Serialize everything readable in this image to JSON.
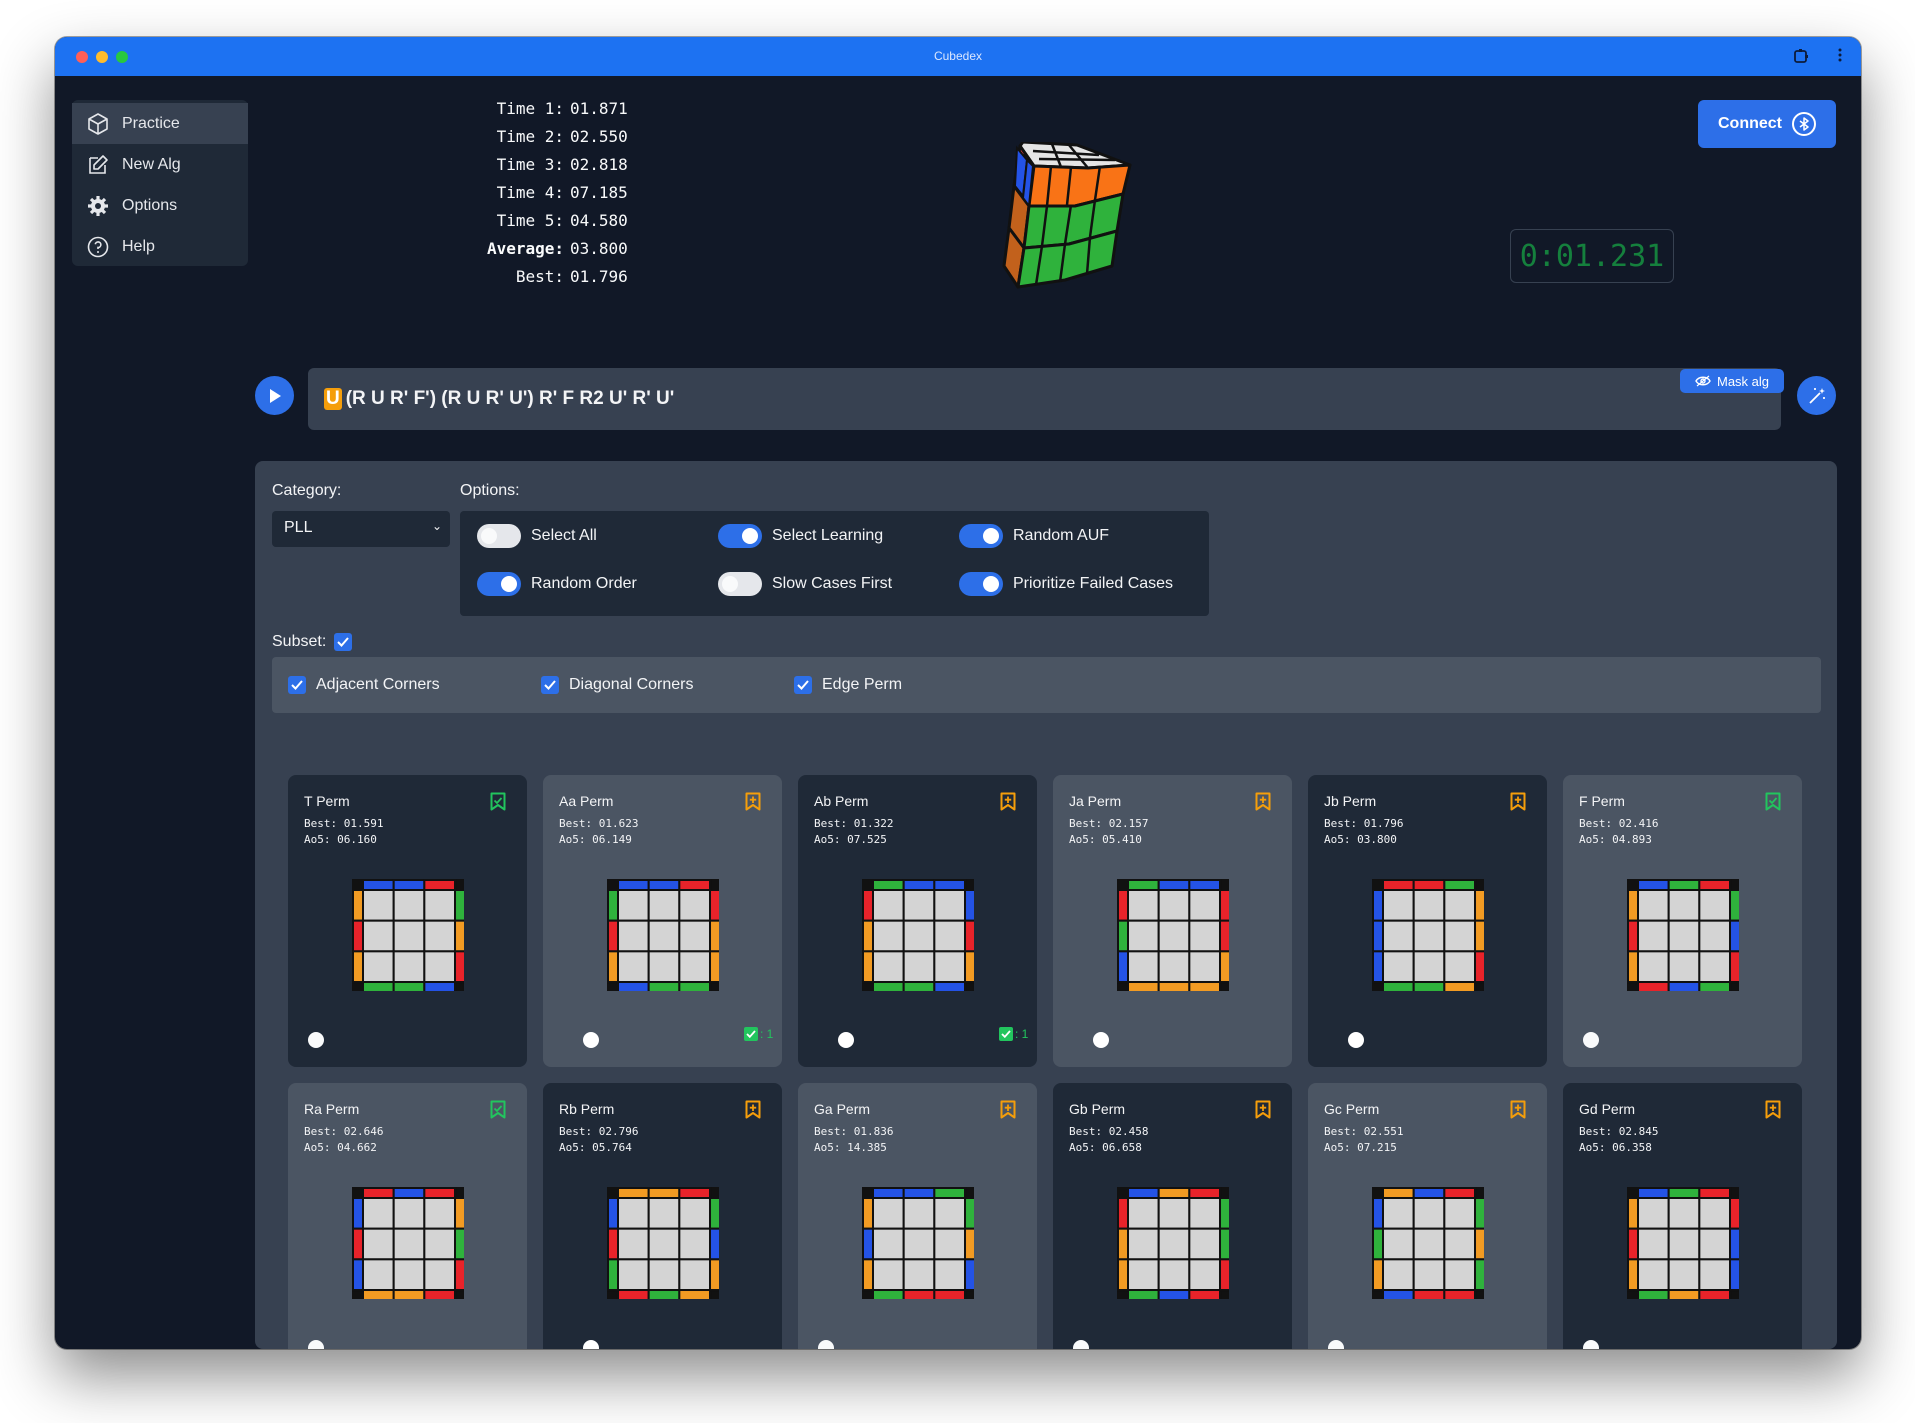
{
  "window": {
    "title": "Cubedex"
  },
  "sidebar": {
    "items": [
      {
        "label": "Practice",
        "icon": "cube-icon",
        "active": true
      },
      {
        "label": "New Alg",
        "icon": "edit-icon",
        "active": false
      },
      {
        "label": "Options",
        "icon": "gear-icon",
        "active": false
      },
      {
        "label": "Help",
        "icon": "help-circle-icon",
        "active": false
      }
    ]
  },
  "stats": {
    "rows": [
      {
        "label": "Time 1:",
        "value": "01.871"
      },
      {
        "label": "Time 2:",
        "value": "02.550"
      },
      {
        "label": "Time 3:",
        "value": "02.818"
      },
      {
        "label": "Time 4:",
        "value": "07.185"
      },
      {
        "label": "Time 5:",
        "value": "04.580"
      },
      {
        "label": "Average:",
        "value": "03.800"
      },
      {
        "label": "Best:",
        "value": "01.796"
      }
    ]
  },
  "connect": {
    "label": "Connect"
  },
  "timer": {
    "value": "0:01.231"
  },
  "alg": {
    "current_move": "U",
    "rest": "(R U R' F') (R U R' U') R' F R2 U' R' U'",
    "mask_label": "Mask alg"
  },
  "panel": {
    "category_label": "Category:",
    "category_value": "PLL",
    "options_label": "Options:",
    "options": [
      {
        "label": "Select All",
        "on": false
      },
      {
        "label": "Select Learning",
        "on": true
      },
      {
        "label": "Random AUF",
        "on": true
      },
      {
        "label": "Random Order",
        "on": true
      },
      {
        "label": "Slow Cases First",
        "on": false
      },
      {
        "label": "Prioritize Failed Cases",
        "on": true
      }
    ],
    "subset_label": "Subset:",
    "subsets": [
      {
        "label": "Adjacent Corners",
        "checked": true
      },
      {
        "label": "Diagonal Corners",
        "checked": true
      },
      {
        "label": "Edge Perm",
        "checked": true
      }
    ]
  },
  "colors": {
    "accent": "#2d6fe8",
    "red": "#e8232a",
    "blue": "#2453e6",
    "green": "#2fb23c",
    "orange": "#f29b23",
    "sticker": "#d4d4d4"
  },
  "cases": [
    {
      "name": "T Perm",
      "best": "Best: 01.591",
      "ao5": "Ao5: 06.160",
      "bookmark": "learned",
      "enabled": false,
      "count": "",
      "edges": {
        "top": [
          "b",
          "b",
          "r"
        ],
        "right": [
          "g",
          "o",
          "r"
        ],
        "bottom": [
          "g",
          "g",
          "b"
        ],
        "left": [
          "o",
          "r",
          "o"
        ]
      }
    },
    {
      "name": "Aa Perm",
      "best": "Best: 01.623",
      "ao5": "Ao5: 06.149",
      "bookmark": "learning",
      "enabled": true,
      "count": ": 1",
      "edges": {
        "top": [
          "b",
          "b",
          "r"
        ],
        "right": [
          "r",
          "o",
          "o"
        ],
        "bottom": [
          "b",
          "g",
          "g"
        ],
        "left": [
          "g",
          "r",
          "o"
        ]
      }
    },
    {
      "name": "Ab Perm",
      "best": "Best: 01.322",
      "ao5": "Ao5: 07.525",
      "bookmark": "learning",
      "enabled": true,
      "count": ": 1",
      "edges": {
        "top": [
          "g",
          "b",
          "b"
        ],
        "right": [
          "b",
          "r",
          "o"
        ],
        "bottom": [
          "g",
          "g",
          "b"
        ],
        "left": [
          "r",
          "o",
          "o"
        ]
      }
    },
    {
      "name": "Ja Perm",
      "best": "Best: 02.157",
      "ao5": "Ao5: 05.410",
      "bookmark": "learning",
      "enabled": true,
      "count": "",
      "edges": {
        "top": [
          "g",
          "b",
          "b"
        ],
        "right": [
          "r",
          "r",
          "o"
        ],
        "bottom": [
          "o",
          "o",
          "o"
        ],
        "left": [
          "r",
          "g",
          "b"
        ]
      }
    },
    {
      "name": "Jb Perm",
      "best": "Best: 01.796",
      "ao5": "Ao5: 03.800",
      "bookmark": "learning",
      "enabled": true,
      "count": "",
      "edges": {
        "top": [
          "r",
          "r",
          "g"
        ],
        "right": [
          "o",
          "o",
          "r"
        ],
        "bottom": [
          "g",
          "g",
          "o"
        ],
        "left": [
          "b",
          "b",
          "b"
        ]
      }
    },
    {
      "name": "F Perm",
      "best": "Best: 02.416",
      "ao5": "Ao5: 04.893",
      "bookmark": "learned",
      "enabled": false,
      "count": "",
      "edges": {
        "top": [
          "b",
          "g",
          "r"
        ],
        "right": [
          "g",
          "b",
          "r"
        ],
        "bottom": [
          "r",
          "b",
          "g"
        ],
        "left": [
          "o",
          "r",
          "o"
        ]
      }
    },
    {
      "name": "Ra Perm",
      "best": "Best: 02.646",
      "ao5": "Ao5: 04.662",
      "bookmark": "learned",
      "enabled": false,
      "count": "",
      "edges": {
        "top": [
          "r",
          "b",
          "r"
        ],
        "right": [
          "o",
          "g",
          "r"
        ],
        "bottom": [
          "o",
          "o",
          "r"
        ],
        "left": [
          "b",
          "r",
          "b"
        ]
      }
    },
    {
      "name": "Rb Perm",
      "best": "Best: 02.796",
      "ao5": "Ao5: 05.764",
      "bookmark": "learning",
      "enabled": true,
      "count": "",
      "edges": {
        "top": [
          "o",
          "o",
          "r"
        ],
        "right": [
          "g",
          "b",
          "o"
        ],
        "bottom": [
          "r",
          "g",
          "o"
        ],
        "left": [
          "b",
          "r",
          "g"
        ]
      }
    },
    {
      "name": "Ga Perm",
      "best": "Best: 01.836",
      "ao5": "Ao5: 14.385",
      "bookmark": "learning",
      "enabled": false,
      "count": "",
      "edges": {
        "top": [
          "b",
          "b",
          "g"
        ],
        "right": [
          "g",
          "o",
          "b"
        ],
        "bottom": [
          "g",
          "r",
          "r"
        ],
        "left": [
          "o",
          "b",
          "o"
        ]
      }
    },
    {
      "name": "Gb Perm",
      "best": "Best: 02.458",
      "ao5": "Ao5: 06.658",
      "bookmark": "learning",
      "enabled": false,
      "count": "",
      "edges": {
        "top": [
          "b",
          "o",
          "r"
        ],
        "right": [
          "g",
          "g",
          "r"
        ],
        "bottom": [
          "g",
          "b",
          "r"
        ],
        "left": [
          "r",
          "o",
          "o"
        ]
      }
    },
    {
      "name": "Gc Perm",
      "best": "Best: 02.551",
      "ao5": "Ao5: 07.215",
      "bookmark": "learning",
      "enabled": false,
      "count": "",
      "edges": {
        "top": [
          "o",
          "b",
          "r"
        ],
        "right": [
          "g",
          "o",
          "g"
        ],
        "bottom": [
          "b",
          "r",
          "r"
        ],
        "left": [
          "b",
          "g",
          "o"
        ]
      }
    },
    {
      "name": "Gd Perm",
      "best": "Best: 02.845",
      "ao5": "Ao5: 06.358",
      "bookmark": "learning",
      "enabled": false,
      "count": "",
      "edges": {
        "top": [
          "b",
          "g",
          "r"
        ],
        "right": [
          "r",
          "b",
          "b"
        ],
        "bottom": [
          "g",
          "o",
          "r"
        ],
        "left": [
          "o",
          "r",
          "o"
        ]
      }
    }
  ]
}
